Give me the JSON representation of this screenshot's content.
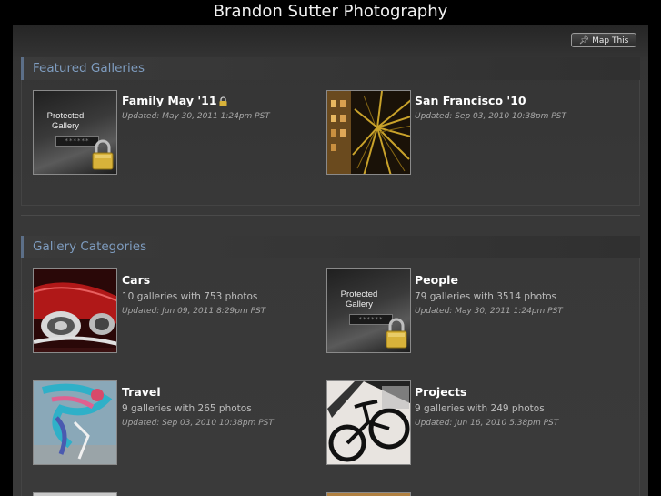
{
  "site": {
    "title": "Brandon Sutter Photography"
  },
  "toolbar": {
    "map_label": "Map This"
  },
  "featured": {
    "heading": "Featured Galleries",
    "items": [
      {
        "title": "Family May '11",
        "updated": "Updated: May 30, 2011 1:24pm PST",
        "thumb": "protected"
      },
      {
        "title": "San Francisco '10",
        "updated": "Updated: Sep 03, 2010 10:38pm PST",
        "thumb": "palm-night"
      }
    ]
  },
  "categories": {
    "heading": "Gallery Categories",
    "items": [
      {
        "title": "Cars",
        "count": "10 galleries with 753 photos",
        "updated": "Updated: Jun 09, 2011 8:29pm PST",
        "thumb": "red-car"
      },
      {
        "title": "People",
        "count": "79 galleries with 3514 photos",
        "updated": "Updated: May 30, 2011 1:24pm PST",
        "thumb": "protected"
      },
      {
        "title": "Travel",
        "count": "9 galleries with 265 photos",
        "updated": "Updated: Sep 03, 2010 10:38pm PST",
        "thumb": "graffiti"
      },
      {
        "title": "Projects",
        "count": "9 galleries with 249 photos",
        "updated": "Updated: Jun 16, 2010 5:38pm PST",
        "thumb": "bicycle"
      }
    ]
  },
  "protected_label": "Protected Gallery",
  "protected_dots": "******",
  "colors": {
    "background": "#000000",
    "panel": "#383838",
    "heading": "#7e9cbf",
    "accent_bar": "#5c6f88"
  }
}
